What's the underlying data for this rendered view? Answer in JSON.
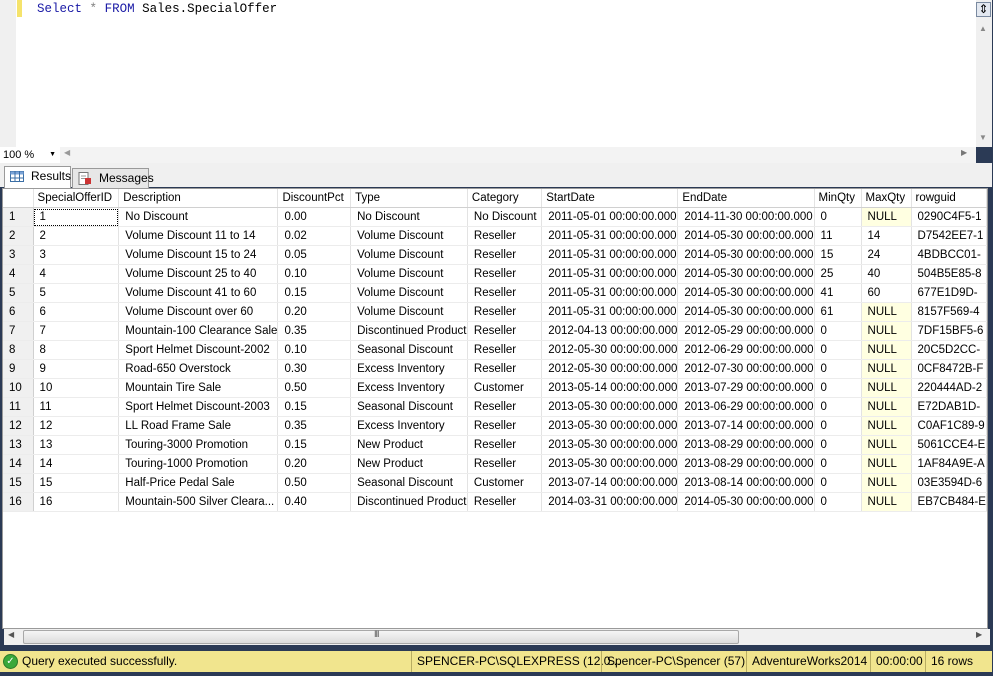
{
  "editor": {
    "tokens": {
      "select": "Select",
      "star": "*",
      "from": "FROM",
      "table": "Sales.SpecialOffer"
    }
  },
  "zoom": {
    "value": "100 %"
  },
  "tabs": [
    {
      "label": "Results",
      "icon": "grid-icon",
      "active": true
    },
    {
      "label": "Messages",
      "icon": "messages-icon",
      "active": false
    }
  ],
  "grid": {
    "columns": [
      "SpecialOfferID",
      "Description",
      "DiscountPct",
      "Type",
      "Category",
      "StartDate",
      "EndDate",
      "MinQty",
      "MaxQty",
      "rowguid"
    ],
    "rows": [
      [
        "1",
        "1",
        "No Discount",
        "0.00",
        "No Discount",
        "No Discount",
        "2011-05-01 00:00:00.000",
        "2014-11-30 00:00:00.000",
        "0",
        "NULL",
        "0290C4F5-1"
      ],
      [
        "2",
        "2",
        "Volume Discount 11 to 14",
        "0.02",
        "Volume Discount",
        "Reseller",
        "2011-05-31 00:00:00.000",
        "2014-05-30 00:00:00.000",
        "11",
        "14",
        "D7542EE7-1"
      ],
      [
        "3",
        "3",
        "Volume Discount 15 to 24",
        "0.05",
        "Volume Discount",
        "Reseller",
        "2011-05-31 00:00:00.000",
        "2014-05-30 00:00:00.000",
        "15",
        "24",
        "4BDBCC01-"
      ],
      [
        "4",
        "4",
        "Volume Discount 25 to 40",
        "0.10",
        "Volume Discount",
        "Reseller",
        "2011-05-31 00:00:00.000",
        "2014-05-30 00:00:00.000",
        "25",
        "40",
        "504B5E85-8"
      ],
      [
        "5",
        "5",
        "Volume Discount 41 to 60",
        "0.15",
        "Volume Discount",
        "Reseller",
        "2011-05-31 00:00:00.000",
        "2014-05-30 00:00:00.000",
        "41",
        "60",
        "677E1D9D-"
      ],
      [
        "6",
        "6",
        "Volume Discount over 60",
        "0.20",
        "Volume Discount",
        "Reseller",
        "2011-05-31 00:00:00.000",
        "2014-05-30 00:00:00.000",
        "61",
        "NULL",
        "8157F569-4"
      ],
      [
        "7",
        "7",
        "Mountain-100 Clearance Sale",
        "0.35",
        "Discontinued Product",
        "Reseller",
        "2012-04-13 00:00:00.000",
        "2012-05-29 00:00:00.000",
        "0",
        "NULL",
        "7DF15BF5-6"
      ],
      [
        "8",
        "8",
        "Sport Helmet Discount-2002",
        "0.10",
        "Seasonal Discount",
        "Reseller",
        "2012-05-30 00:00:00.000",
        "2012-06-29 00:00:00.000",
        "0",
        "NULL",
        "20C5D2CC-"
      ],
      [
        "9",
        "9",
        "Road-650 Overstock",
        "0.30",
        "Excess Inventory",
        "Reseller",
        "2012-05-30 00:00:00.000",
        "2012-07-30 00:00:00.000",
        "0",
        "NULL",
        "0CF8472B-F"
      ],
      [
        "10",
        "10",
        "Mountain Tire Sale",
        "0.50",
        "Excess Inventory",
        "Customer",
        "2013-05-14 00:00:00.000",
        "2013-07-29 00:00:00.000",
        "0",
        "NULL",
        "220444AD-2"
      ],
      [
        "11",
        "11",
        "Sport Helmet Discount-2003",
        "0.15",
        "Seasonal Discount",
        "Reseller",
        "2013-05-30 00:00:00.000",
        "2013-06-29 00:00:00.000",
        "0",
        "NULL",
        "E72DAB1D-"
      ],
      [
        "12",
        "12",
        "LL Road Frame Sale",
        "0.35",
        "Excess Inventory",
        "Reseller",
        "2013-05-30 00:00:00.000",
        "2013-07-14 00:00:00.000",
        "0",
        "NULL",
        "C0AF1C89-9"
      ],
      [
        "13",
        "13",
        "Touring-3000 Promotion",
        "0.15",
        "New Product",
        "Reseller",
        "2013-05-30 00:00:00.000",
        "2013-08-29 00:00:00.000",
        "0",
        "NULL",
        "5061CCE4-E"
      ],
      [
        "14",
        "14",
        "Touring-1000 Promotion",
        "0.20",
        "New Product",
        "Reseller",
        "2013-05-30 00:00:00.000",
        "2013-08-29 00:00:00.000",
        "0",
        "NULL",
        "1AF84A9E-A"
      ],
      [
        "15",
        "15",
        "Half-Price Pedal Sale",
        "0.50",
        "Seasonal Discount",
        "Customer",
        "2013-07-14 00:00:00.000",
        "2013-08-14 00:00:00.000",
        "0",
        "NULL",
        "03E3594D-6"
      ],
      [
        "16",
        "16",
        "Mountain-500 Silver Cleara...",
        "0.40",
        "Discontinued Product",
        "Reseller",
        "2014-03-31 00:00:00.000",
        "2014-05-30 00:00:00.000",
        "0",
        "NULL",
        "EB7CB484-E"
      ]
    ]
  },
  "hscroll": {
    "grip": "III"
  },
  "status": {
    "message": "Query executed successfully.",
    "server": "SPENCER-PC\\SQLEXPRESS (12.0...",
    "user": "Spencer-PC\\Spencer (57)",
    "database": "AdventureWorks2014",
    "elapsed": "00:00:00",
    "rows": "16 rows",
    "colors": {
      "bar": "#f1e58e",
      "null_cell": "#ffffe1",
      "keyword": "#1a1aa6"
    }
  }
}
